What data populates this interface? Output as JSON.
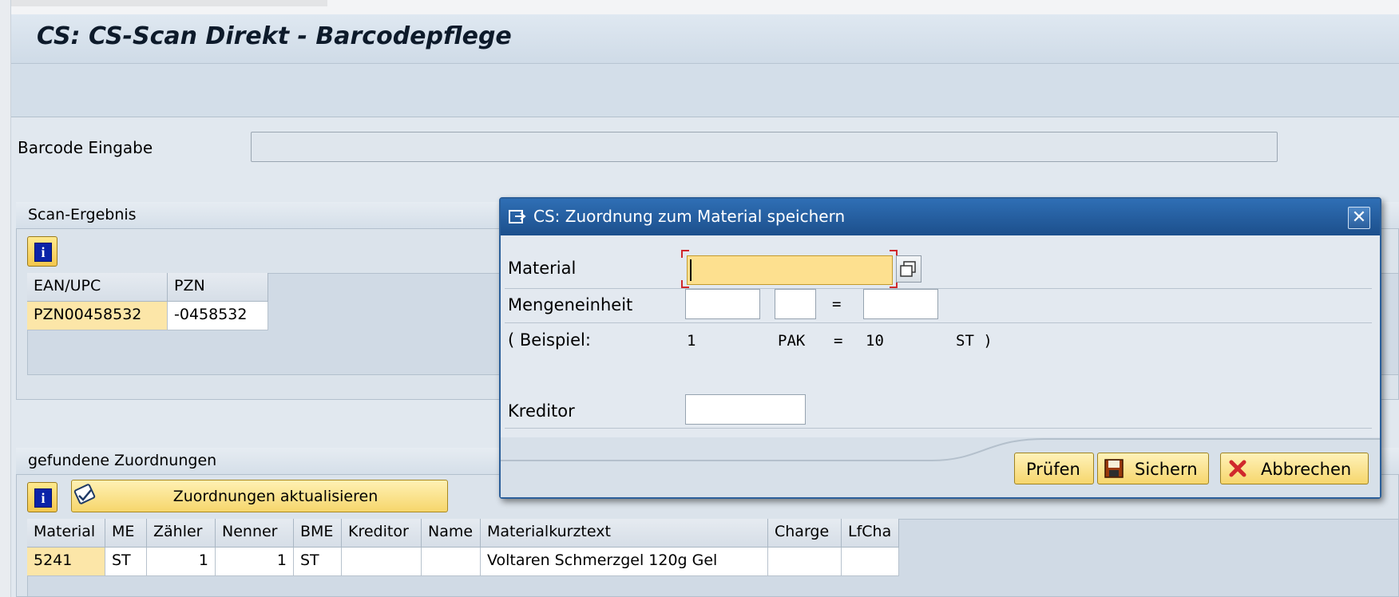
{
  "window": {
    "title": "CS: CS-Scan Direkt - Barcodepflege"
  },
  "barcode": {
    "label": "Barcode Eingabe",
    "value": ""
  },
  "scan_result": {
    "title": "Scan-Ergebnis",
    "columns": [
      "EAN/UPC",
      "PZN"
    ],
    "rows": [
      {
        "ean": "PZN00458532",
        "pzn": "-0458532"
      }
    ]
  },
  "found": {
    "title": "gefundene Zuordnungen",
    "update_button": "Zuordnungen aktualisieren",
    "columns": [
      "Material",
      "ME",
      "Zähler",
      "Nenner",
      "BME",
      "Kreditor",
      "Name",
      "Materialkurztext",
      "Charge",
      "LfCha"
    ],
    "rows": [
      {
        "material": "5241",
        "me": "ST",
        "zaehler": "1",
        "nenner": "1",
        "bme": "ST",
        "kreditor": "",
        "name": "",
        "text": "Voltaren Schmerzgel 120g Gel",
        "charge": "",
        "lfcha": ""
      }
    ]
  },
  "dialog": {
    "title": "CS: Zuordnung zum Material speichern",
    "close_glyph": "✕",
    "material_label": "Material",
    "material_value": "",
    "unit_label": "Mengeneinheit",
    "equals": "=",
    "example": {
      "prefix": "( Beispiel:",
      "qty": "1",
      "unit": "PAK",
      "eq": "=",
      "qty2": "10",
      "unit2": "ST )"
    },
    "vendor_label": "Kreditor",
    "buttons": {
      "check": "Prüfen",
      "save": "Sichern",
      "cancel": "Abbrechen"
    }
  },
  "icons": {
    "info": "info-icon",
    "refresh": "refresh-icon",
    "dialog": "dialog-icon",
    "save": "floppy-disk-icon",
    "cancel": "red-x-icon",
    "f4": "value-help-icon"
  },
  "colors": {
    "title_bar": "#1c4f8c",
    "key_cell": "#fce6a8",
    "button": "#f6d66d",
    "cancel_x": "#d0282c"
  }
}
